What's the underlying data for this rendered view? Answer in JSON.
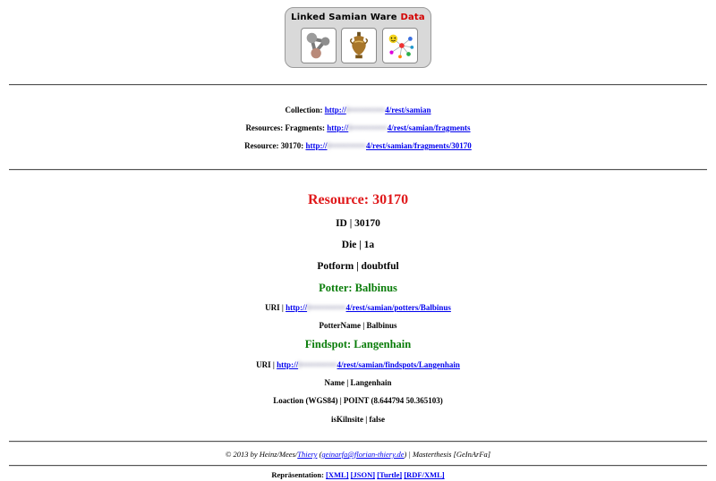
{
  "logo": {
    "title_main": "Linked Samian Ware",
    "title_accent": "Data",
    "accent_color": "#d40000",
    "icons": [
      "molecule-icon",
      "amphora-icon",
      "social-network-icon"
    ]
  },
  "links": {
    "collection": {
      "label": "Collection:",
      "prefix": "http://",
      "hidden": "l•••••••••••••",
      "suffix": "4/rest/samian"
    },
    "fragments": {
      "label": "Resources: Fragments:",
      "prefix": "http://",
      "hidden": "l•••••••••••••",
      "suffix": "4/rest/samian/fragments"
    },
    "resource": {
      "label": "Resource: 30170:",
      "prefix": "http://",
      "hidden": "l•••••••••••••",
      "suffix": "4/rest/samian/fragments/30170"
    }
  },
  "resource": {
    "title": "Resource: 30170",
    "id": "ID | 30170",
    "die": "Die | 1a",
    "potform": "Potform | doubtful"
  },
  "potter": {
    "heading": "Potter: Balbinus",
    "uri_label": "URI |",
    "uri_prefix": "http://",
    "uri_hidden": "l•••••••••••••",
    "uri_suffix": "4/rest/samian/potters/Balbinus",
    "name": "PotterName | Balbinus"
  },
  "findspot": {
    "heading": "Findspot: Langenhain",
    "uri_label": "URI |",
    "uri_prefix": "http://",
    "uri_hidden": "l•••••••••••••",
    "uri_suffix": "4/rest/samian/findspots/Langenhain",
    "name": "Name | Langenhain",
    "location": "Loaction (WGS84) | POINT (8.644794 50.365103)",
    "kiln": "isKilnsite | false"
  },
  "footer": {
    "copyright_pre": "© 2013 by Heinz/Mees/",
    "author_link": "Thiery",
    "mid": "(",
    "email": "geinarfa@florian-thiery.de",
    "post": ") | Masterthesis [GeInArFa]"
  },
  "representation": {
    "label": "Repräsentation:",
    "formats": [
      "[XML]",
      "[JSON]",
      "[Turtle]",
      "[RDF/XML]"
    ]
  }
}
